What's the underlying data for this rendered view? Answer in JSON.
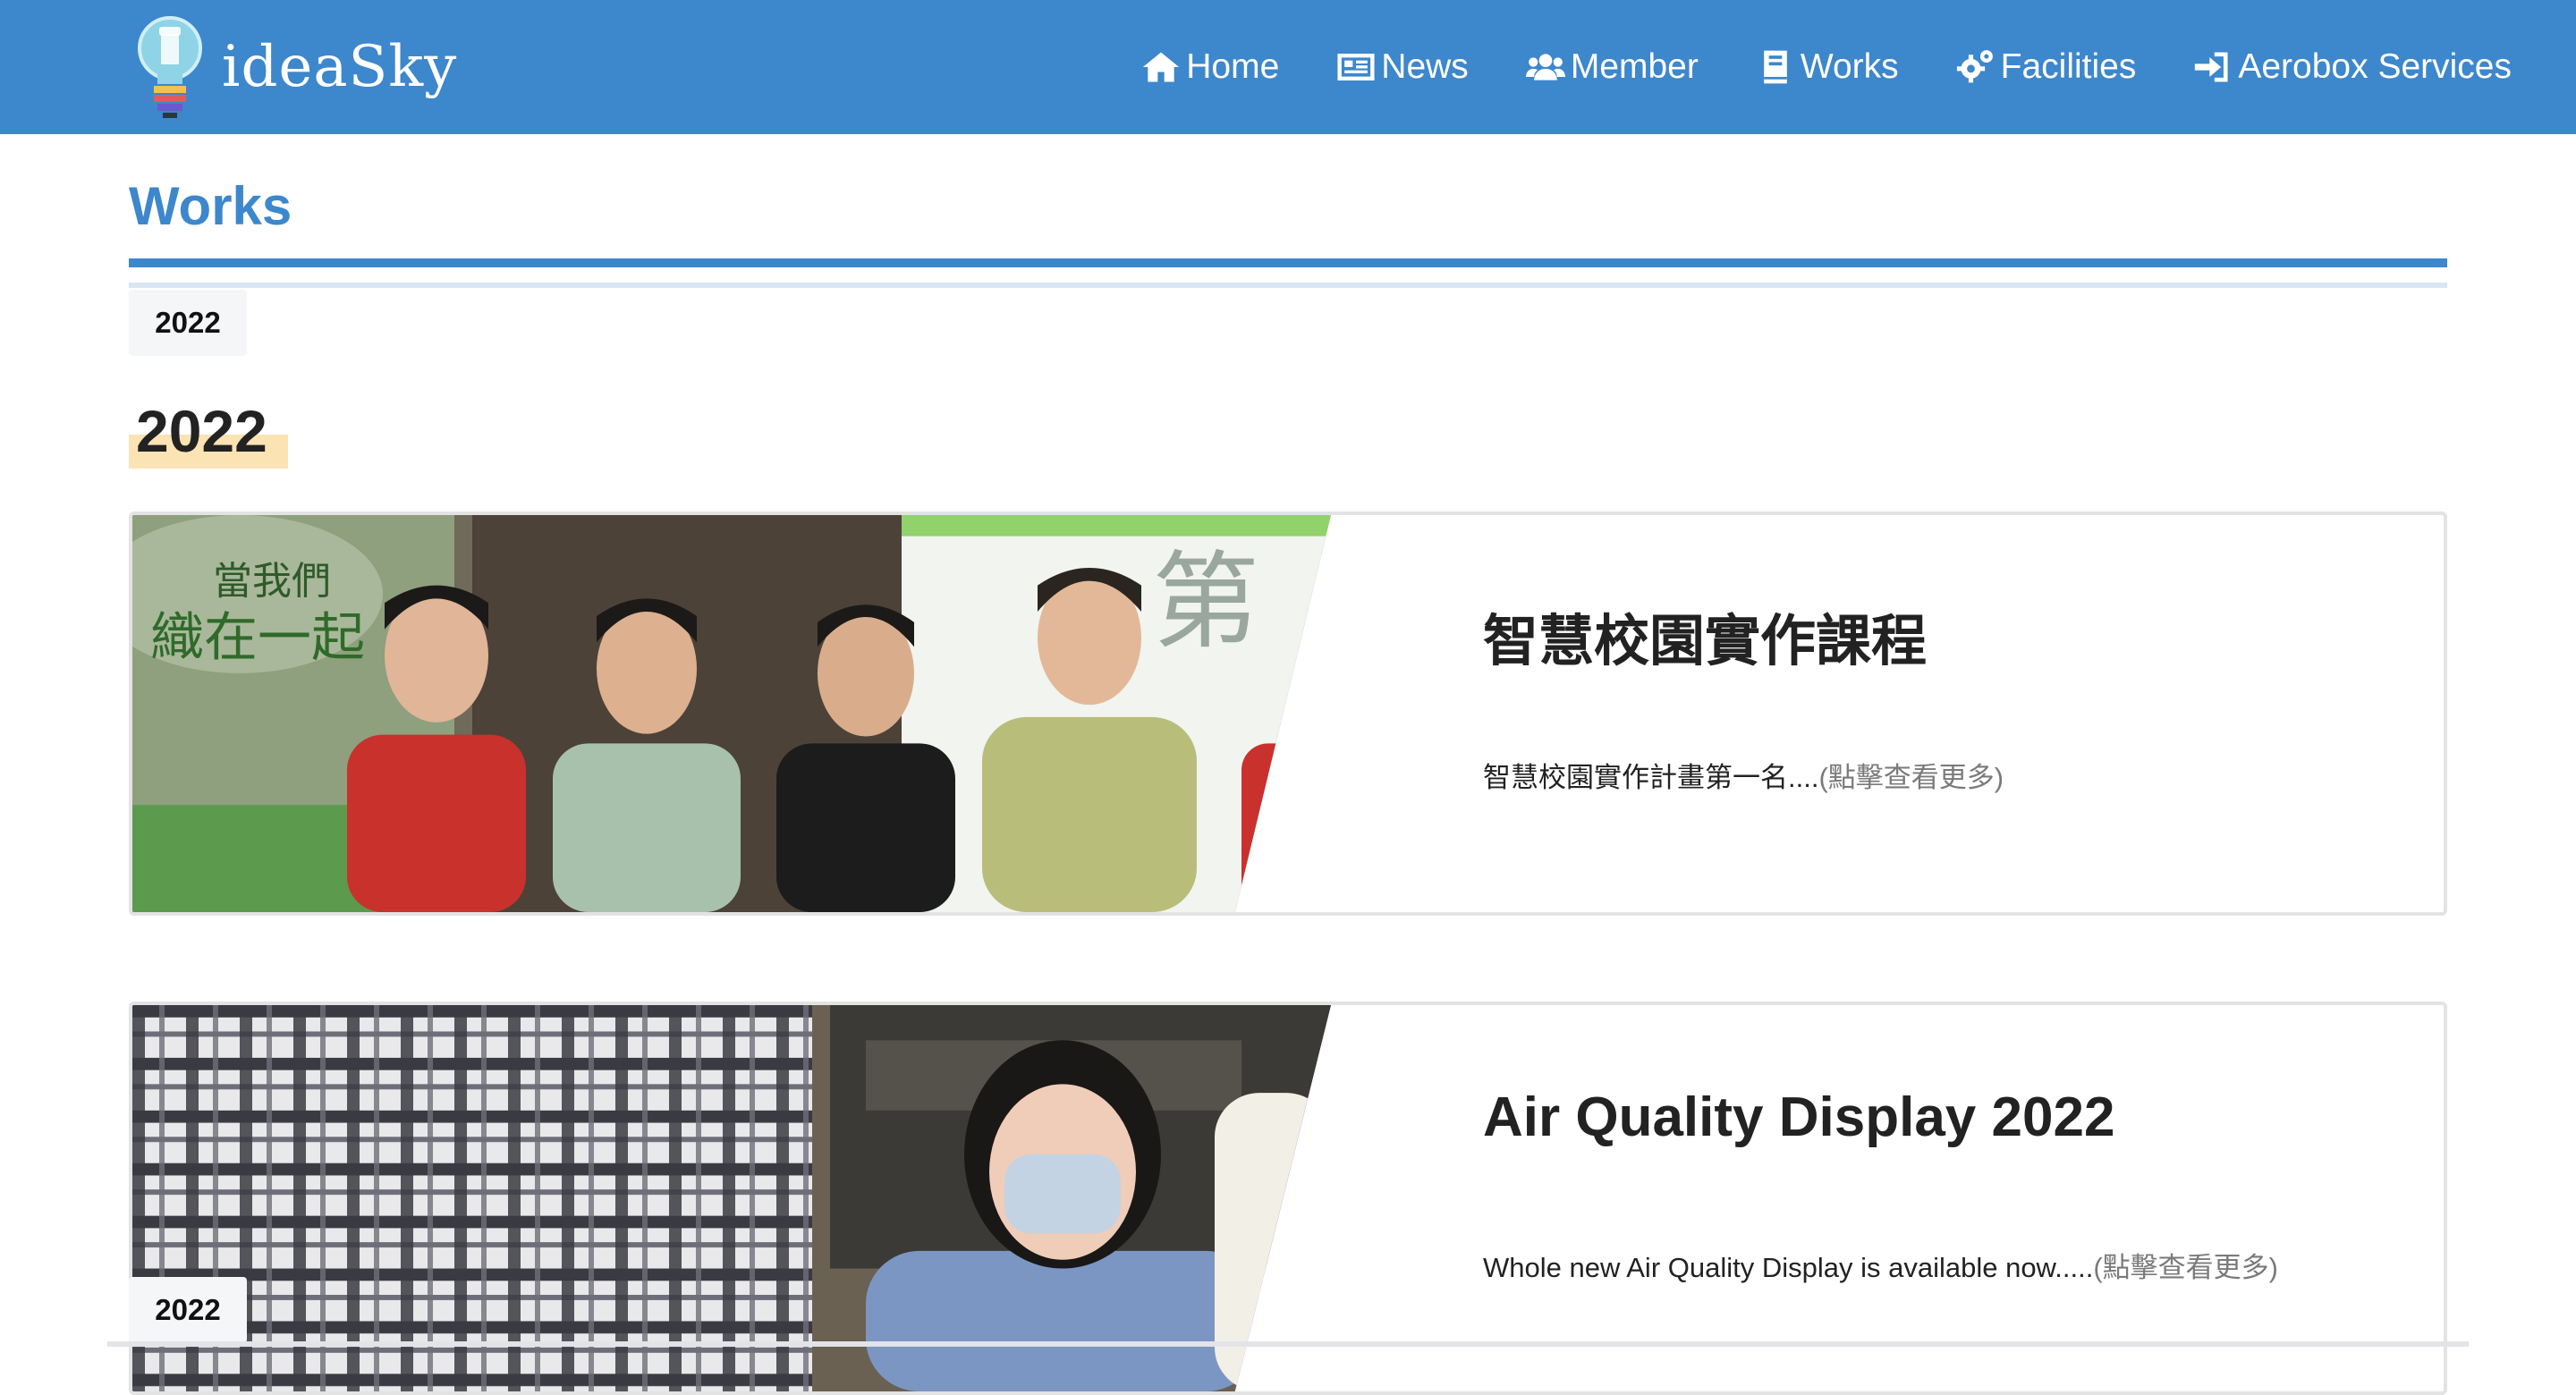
{
  "brand": {
    "name": "ideaSky"
  },
  "nav": {
    "items": [
      {
        "label": "Home",
        "icon": "home-icon"
      },
      {
        "label": "News",
        "icon": "newspaper-icon"
      },
      {
        "label": "Member",
        "icon": "users-icon"
      },
      {
        "label": "Works",
        "icon": "book-icon"
      },
      {
        "label": "Facilities",
        "icon": "gears-icon"
      },
      {
        "label": "Aerobox Services",
        "icon": "sign-in-icon"
      }
    ]
  },
  "page": {
    "title": "Works",
    "year_filter": "2022",
    "year_heading": "2022"
  },
  "cards": [
    {
      "title": "智慧校園實作課程",
      "description": "智慧校園實作計畫第一名....",
      "more": "(點擊查看更多)"
    },
    {
      "title": "Air Quality Display 2022",
      "description": "Whole new Air Quality Display is available now.....",
      "more": "(點擊查看更多)"
    }
  ],
  "footer_chip": "2022",
  "colors": {
    "brand_blue": "#3d87cc",
    "highlight": "#fbe3b4",
    "chip_bg": "#f5f6f7"
  }
}
